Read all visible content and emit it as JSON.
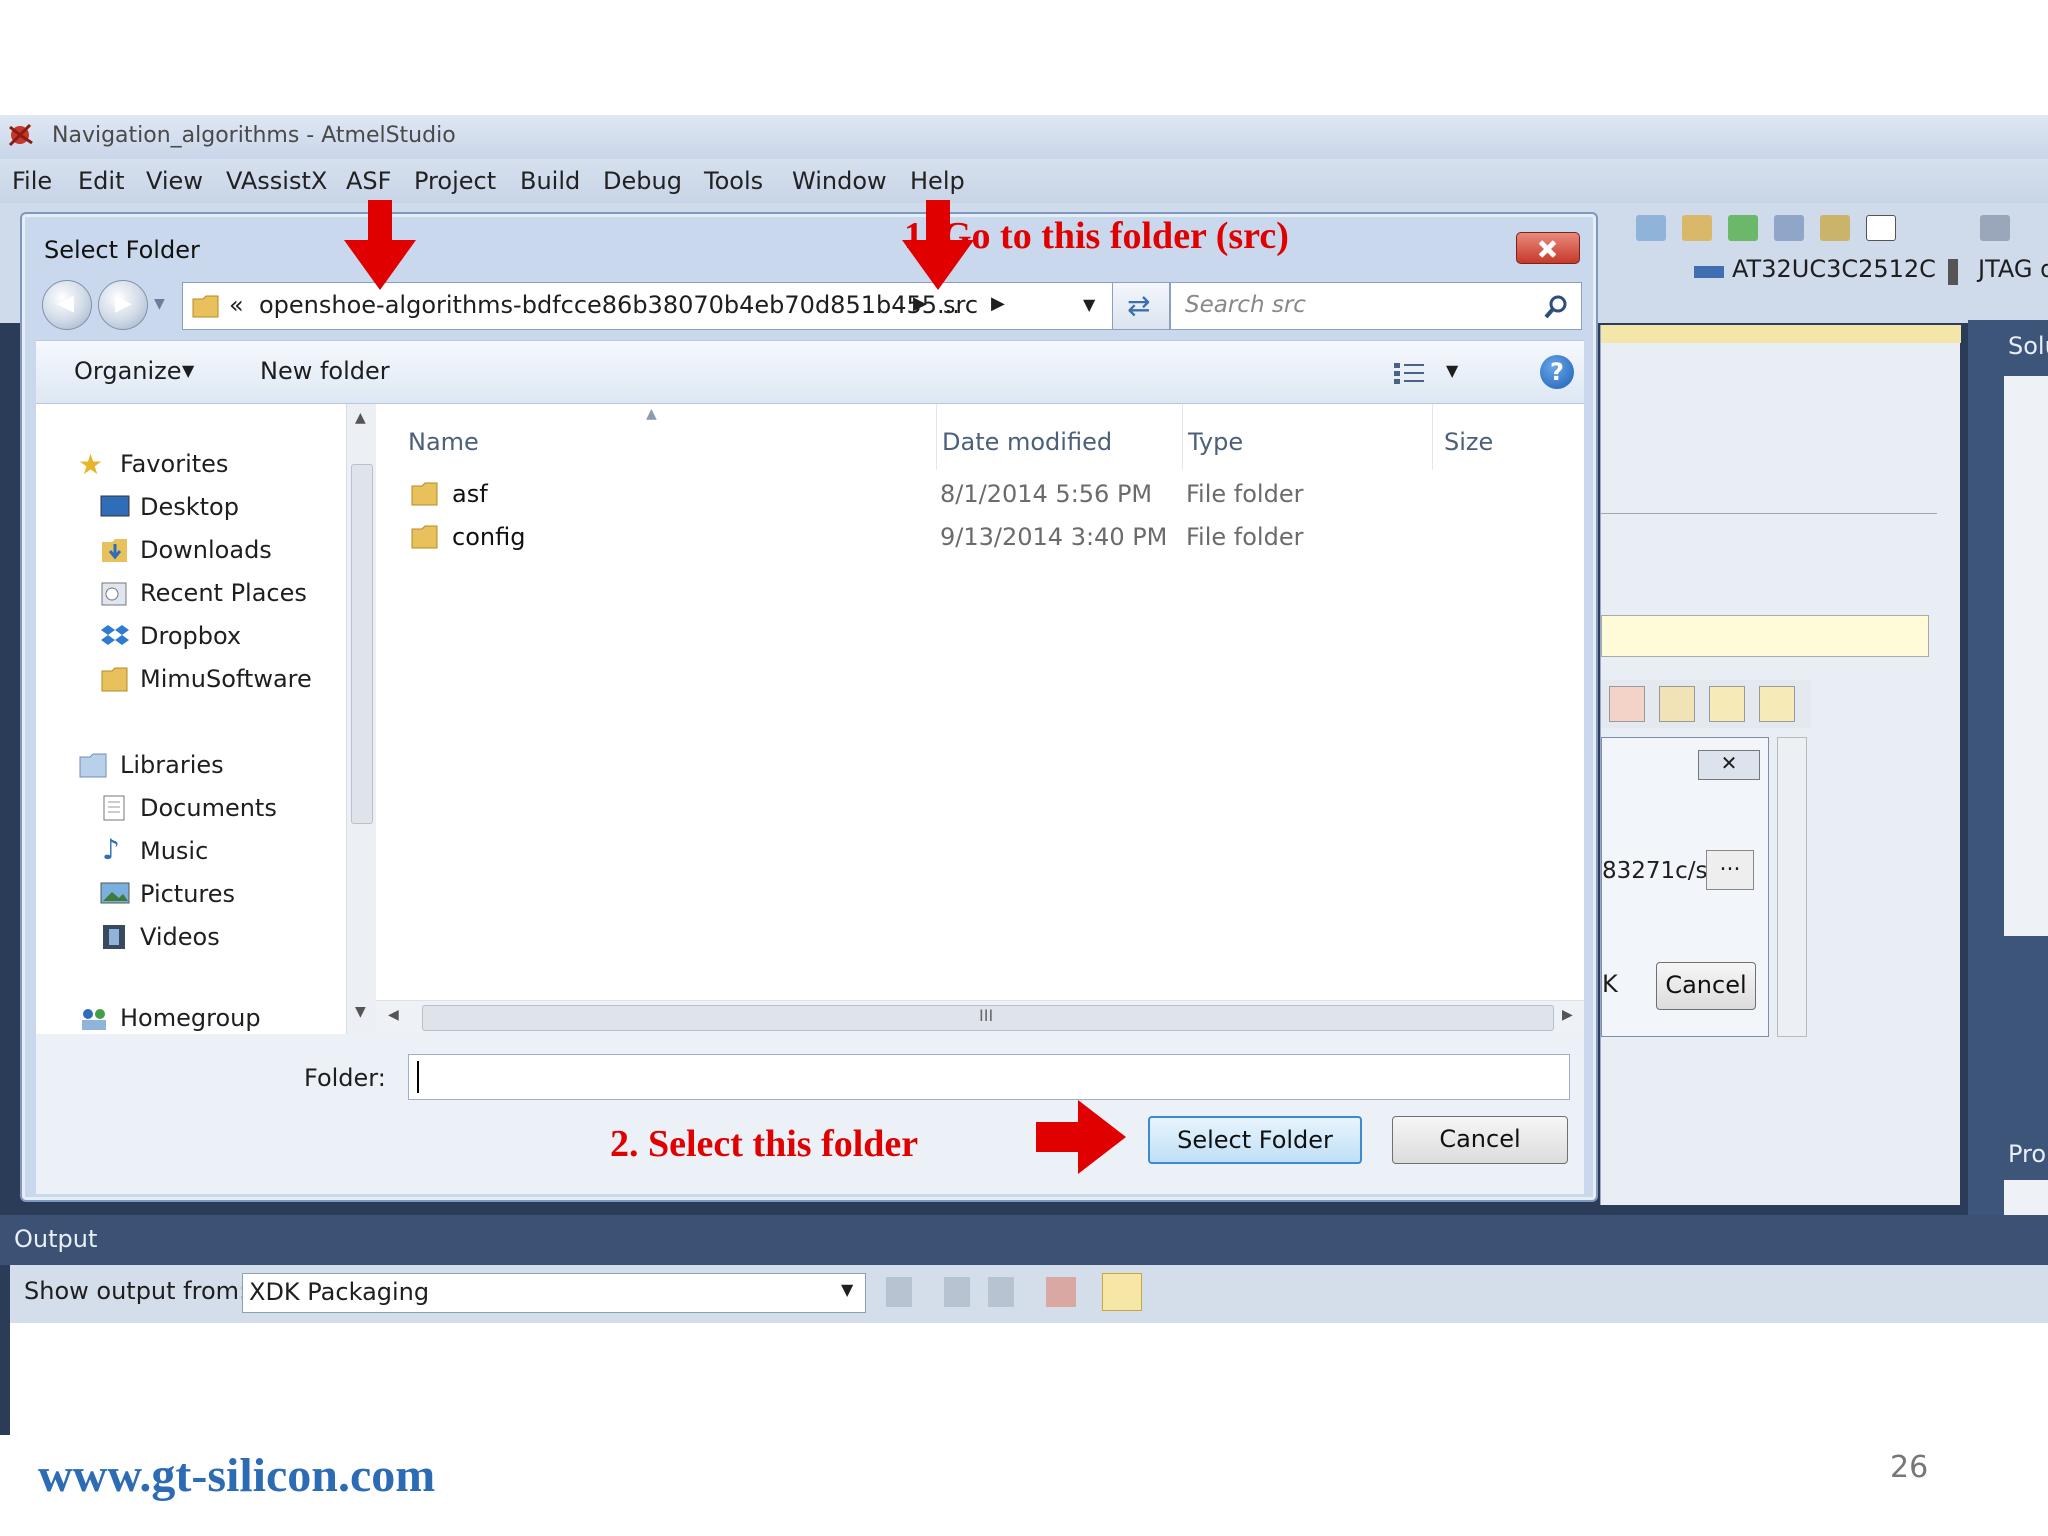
{
  "window": {
    "title": "Navigation_algorithms - AtmelStudio"
  },
  "menu": [
    "File",
    "Edit",
    "View",
    "VAssistX",
    "ASF",
    "Project",
    "Build",
    "Debug",
    "Tools",
    "Window",
    "Help"
  ],
  "toolbar": {
    "device": "AT32UC3C2512C",
    "tool": "JTAG d"
  },
  "right_panels": {
    "solution_tab": "Solu",
    "properties_tab": "Pro",
    "path_fragment": "83271c/s",
    "browse_label": "...",
    "cancel_label": "Cancel",
    "k_fragment": "K"
  },
  "dialog": {
    "title": "Select Folder",
    "address": {
      "prefix": "«",
      "path_segment": "openshoe-algorithms-bdfcce86b38070b4eb70d851b455...",
      "current": "src"
    },
    "search_placeholder": "Search src",
    "organize_label": "Organize",
    "new_folder_label": "New folder",
    "nav": {
      "favorites": {
        "label": "Favorites",
        "items": [
          "Desktop",
          "Downloads",
          "Recent Places",
          "Dropbox",
          "MimuSoftware"
        ]
      },
      "libraries": {
        "label": "Libraries",
        "items": [
          "Documents",
          "Music",
          "Pictures",
          "Videos"
        ]
      },
      "homegroup": "Homegroup"
    },
    "columns": [
      "Name",
      "Date modified",
      "Type",
      "Size"
    ],
    "files": [
      {
        "name": "asf",
        "date": "8/1/2014 5:56 PM",
        "type": "File folder",
        "size": ""
      },
      {
        "name": "config",
        "date": "9/13/2014 3:40 PM",
        "type": "File folder",
        "size": ""
      }
    ],
    "hscroll_grip": "III",
    "folder_label": "Folder:",
    "folder_value": "",
    "select_label": "Select Folder",
    "cancel_label": "Cancel"
  },
  "output": {
    "title": "Output",
    "show_from_label": "Show output from:",
    "source": "XDK Packaging"
  },
  "annotations": {
    "step1": "1. Go to this folder (src)",
    "step2": "2. Select this folder",
    "color": "#e00000"
  },
  "footer": {
    "site": "www.gt-silicon.com",
    "page": "26"
  }
}
